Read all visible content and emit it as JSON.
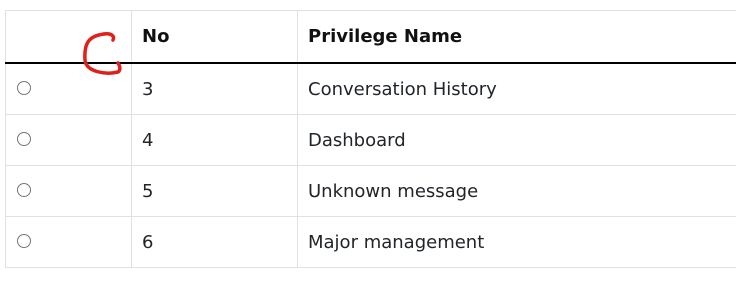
{
  "table": {
    "headers": {
      "select": "",
      "no": "No",
      "name": "Privilege Name"
    },
    "rows": [
      {
        "no": "3",
        "name": "Conversation History"
      },
      {
        "no": "4",
        "name": "Dashboard"
      },
      {
        "no": "5",
        "name": "Unknown message"
      },
      {
        "no": "6",
        "name": "Major management"
      }
    ]
  },
  "colors": {
    "header_rule": "#000000",
    "grid": "#dee2e6",
    "annotation": "#e0201b"
  },
  "icons": {
    "row_selector": "radio-button",
    "annotation": "hand-drawn-red-mark"
  }
}
